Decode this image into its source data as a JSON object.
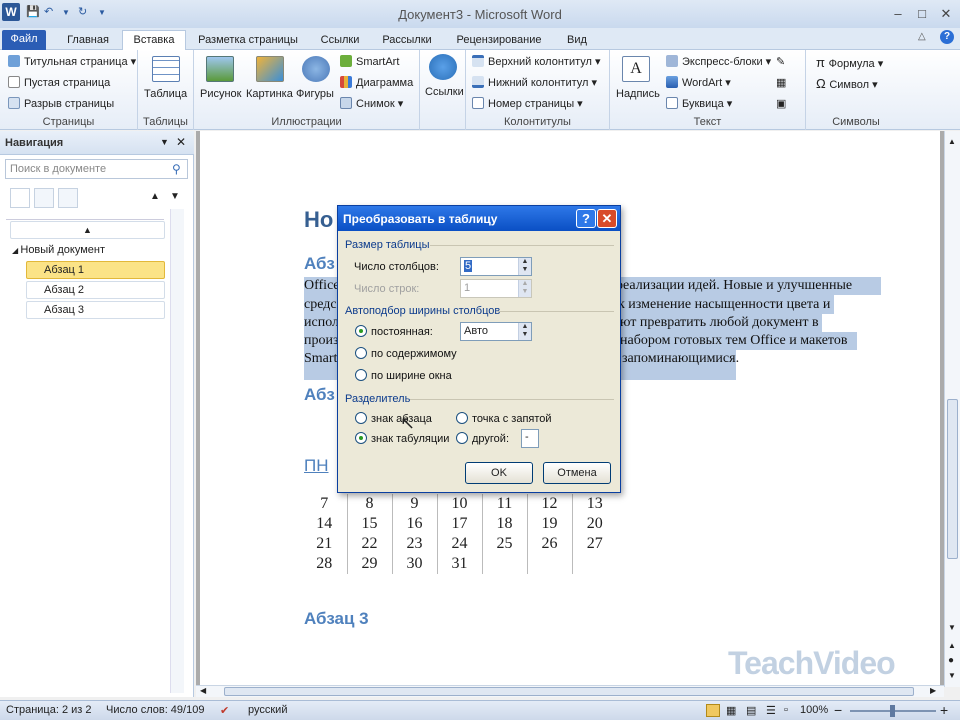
{
  "window": {
    "title": "Документ3 - Microsoft Word"
  },
  "tabs": [
    "Файл",
    "Главная",
    "Вставка",
    "Разметка страницы",
    "Ссылки",
    "Рассылки",
    "Рецензирование",
    "Вид"
  ],
  "ribbon": {
    "pages": {
      "cover": "Титульная страница",
      "blank": "Пустая страница",
      "break": "Разрыв страницы",
      "label": "Страницы"
    },
    "tables": {
      "table": "Таблица",
      "label": "Таблицы"
    },
    "illustrations": {
      "picture": "Рисунок",
      "clipart": "Картинка",
      "shapes": "Фигуры",
      "smartart": "SmartArt",
      "chart": "Диаграмма",
      "screenshot": "Снимок",
      "label": "Иллюстрации"
    },
    "links": {
      "links": "Ссылки"
    },
    "headers": {
      "header": "Верхний колонтитул",
      "footer": "Нижний колонтитул",
      "pagenum": "Номер страницы",
      "label": "Колонтитулы"
    },
    "text": {
      "textbox": "Надпись",
      "quickparts": "Экспресс-блоки",
      "wordart": "WordArt",
      "dropcap": "Буквица",
      "label": "Текст"
    },
    "symbols": {
      "formula": "Формула",
      "symbol": "Символ",
      "label": "Символы"
    }
  },
  "nav": {
    "title": "Навигация",
    "search_placeholder": "Поиск в документе",
    "items": [
      "Новый документ",
      "Абзац 1",
      "Абзац 2",
      "Абзац 3"
    ]
  },
  "doc": {
    "h1": "Но",
    "h2a": "Абз",
    "lines": [
      {
        "a": "Office",
        "b": "реализации идей.        Новые и улучшенные"
      },
      {
        "a": "средс",
        "b": "к изменение насыщенности цвета и"
      },
      {
        "a": "испол",
        "b": "ют превратить любой документ в"
      },
      {
        "a": "произ",
        "b": "набором готовых тем Office и макетов"
      },
      {
        "a": "Smart",
        "b": "запоминающимися."
      }
    ],
    "h2b": "Абз",
    "pn": "ПН",
    "calendar": [
      [
        "7",
        "8",
        "9",
        "10",
        "11",
        "12",
        "13"
      ],
      [
        "14",
        "15",
        "16",
        "17",
        "18",
        "19",
        "20"
      ],
      [
        "21",
        "22",
        "23",
        "24",
        "25",
        "26",
        "27"
      ],
      [
        "28",
        "29",
        "30",
        "31",
        "",
        "",
        ""
      ]
    ],
    "h2c": "Абзац 3"
  },
  "dialog": {
    "title": "Преобразовать в таблицу",
    "size_section": "Размер таблицы",
    "cols_label": "Число столбцов:",
    "cols_value": "5",
    "rows_label": "Число строк:",
    "rows_value": "1",
    "autofit_section": "Автоподбор ширины столбцов",
    "fixed_label": "постоянная:",
    "fixed_value": "Авто",
    "content_label": "по содержимому",
    "window_label": "по ширине окна",
    "sep_section": "Разделитель",
    "para_label": "знак абзаца",
    "semicolon_label": "точка с запятой",
    "tab_label": "знак табуляции",
    "other_label": "другой:",
    "other_value": "-",
    "ok": "OK",
    "cancel": "Отмена"
  },
  "status": {
    "page": "Страница: 2 из 2",
    "words": "Число слов: 49/109",
    "lang": "русский",
    "zoom": "100%"
  },
  "watermark": "TeachVideo"
}
